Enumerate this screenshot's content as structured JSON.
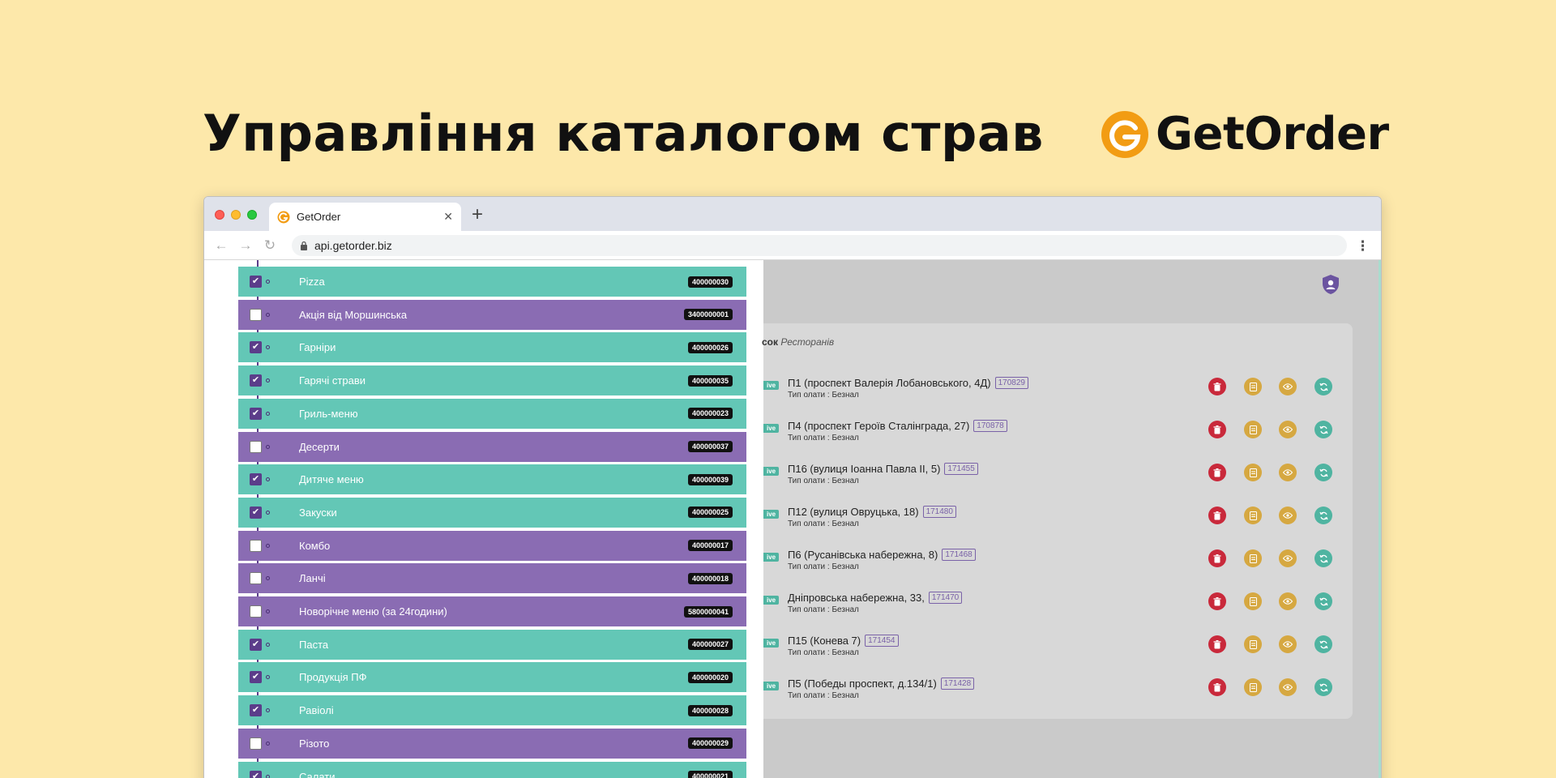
{
  "hero": {
    "title": "Управління каталогом страв"
  },
  "brand": {
    "name": "GetOrder",
    "color": "#f29c13"
  },
  "browser": {
    "tab_title": "GetOrder",
    "url": "api.getorder.biz"
  },
  "categories": [
    {
      "label": "Pizza",
      "code": "400000030",
      "checked": true
    },
    {
      "label": "Акція від Моршинська",
      "code": "3400000001",
      "checked": false
    },
    {
      "label": "Гарніри",
      "code": "400000026",
      "checked": true
    },
    {
      "label": "Гарячі страви",
      "code": "400000035",
      "checked": true
    },
    {
      "label": "Гриль-меню",
      "code": "400000023",
      "checked": true
    },
    {
      "label": "Десерти",
      "code": "400000037",
      "checked": false
    },
    {
      "label": "Дитяче меню",
      "code": "400000039",
      "checked": true
    },
    {
      "label": "Закуски",
      "code": "400000025",
      "checked": true
    },
    {
      "label": "Комбо",
      "code": "400000017",
      "checked": false
    },
    {
      "label": "Ланчі",
      "code": "400000018",
      "checked": false
    },
    {
      "label": "Новорічне меню (за 24години)",
      "code": "5800000041",
      "checked": false
    },
    {
      "label": "Паста",
      "code": "400000027",
      "checked": true
    },
    {
      "label": "Продукція ПФ",
      "code": "400000020",
      "checked": true
    },
    {
      "label": "Равіолі",
      "code": "400000028",
      "checked": true
    },
    {
      "label": "Різото",
      "code": "400000029",
      "checked": false
    },
    {
      "label": "Салати",
      "code": "400000021",
      "checked": true
    }
  ],
  "restaurants_card": {
    "title_bold": "сок",
    "title_italic": "Ресторанів",
    "items": [
      {
        "badge": "ive",
        "name": "П1 (проспект Валерія Лобановського, 4Д)",
        "id": "170829",
        "payment": "Тип олати : Безнал"
      },
      {
        "badge": "ive",
        "name": "П4 (проспект Героїв Сталінграда, 27)",
        "id": "170878",
        "payment": "Тип олати : Безнал"
      },
      {
        "badge": "ive",
        "name": "П16 (вулиця Іоанна Павла ІІ, 5)",
        "id": "171455",
        "payment": "Тип олати : Безнал"
      },
      {
        "badge": "ive",
        "name": "П12 (вулиця Овруцька, 18)",
        "id": "171480",
        "payment": "Тип олати : Безнал"
      },
      {
        "badge": "ive",
        "name": "П6 (Русанівська набережна, 8)",
        "id": "171468",
        "payment": "Тип олати : Безнал"
      },
      {
        "badge": "ive",
        "name": "Дніпровська набережна, 33,",
        "id": "171470",
        "payment": "Тип олати : Безнал"
      },
      {
        "badge": "ive",
        "name": "П15 (Конева 7)",
        "id": "171454",
        "payment": "Тип олати : Безнал"
      },
      {
        "badge": "ive",
        "name": "П5 (Победы проспект, д.134/1)",
        "id": "171428",
        "payment": "Тип олати : Безнал"
      }
    ]
  },
  "colors": {
    "background": "#fde8aa",
    "category_on": "#63c7b6",
    "category_off": "#8a6cb3",
    "delete": "#c9293b",
    "warning": "#d6a841",
    "sync": "#4fb4a1",
    "accent_purple": "#7a62a8"
  },
  "icons": {
    "brand": "getorder-logo",
    "shield": "user-shield-icon",
    "delete": "trash-icon",
    "doc": "document-icon",
    "eye": "eye-icon",
    "sync": "refresh-icon"
  }
}
